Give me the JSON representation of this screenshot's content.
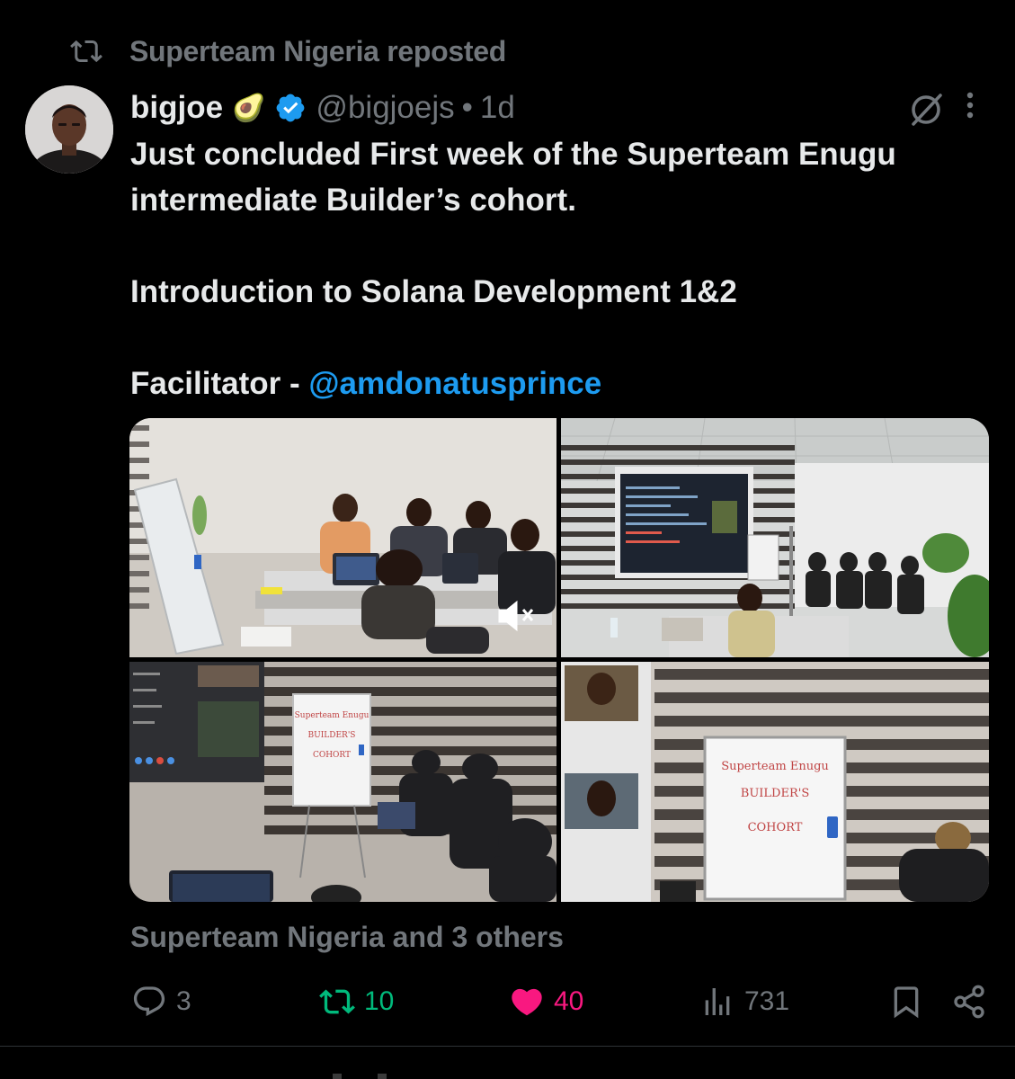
{
  "repost": {
    "label": "Superteam Nigeria reposted",
    "icon": "repost-icon"
  },
  "author": {
    "display_name": "bigjoe",
    "emoji": "🥑",
    "handle": "@bigjoejs",
    "separator": "•",
    "time": "1d",
    "verified": true
  },
  "tweet": {
    "line1": "Just concluded First week of the Superteam  Enugu intermediate Builder’s cohort.",
    "line2": "Introduction to Solana Development 1&2",
    "facilitator_label": "Facilitator - ",
    "facilitator_mention": "@amdonatusprince"
  },
  "media": {
    "whiteboard_1_lines": [
      "Superteam Enugu",
      "BUILDER'S",
      "COHORT"
    ],
    "whiteboard_2_lines": [
      "Superteam Enugu",
      "BUILDER'S",
      "COHORT"
    ]
  },
  "likers": "Superteam Nigeria and 3 others",
  "stats": {
    "replies": "3",
    "reposts": "10",
    "likes": "40",
    "views": "731"
  },
  "colors": {
    "background": "#000000",
    "text": "#e7e9ea",
    "muted": "#71767b",
    "link": "#1d9bf0",
    "repost_green": "#00ba7c",
    "like_pink": "#f91880"
  }
}
